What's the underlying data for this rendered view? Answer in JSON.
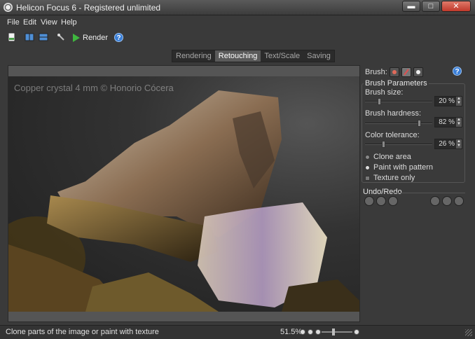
{
  "window": {
    "title": "Helicon Focus 6 - Registered unlimited",
    "minimize": "▬",
    "maximize": "□",
    "close": "✕"
  },
  "menu": [
    "File",
    "Edit",
    "View",
    "Help"
  ],
  "toolbar": {
    "render_label": "Render",
    "help_label": "?"
  },
  "tabs": [
    {
      "label": "Rendering",
      "active": false
    },
    {
      "label": "Retouching",
      "active": true
    },
    {
      "label": "Text/Scale",
      "active": false
    },
    {
      "label": "Saving",
      "active": false
    }
  ],
  "image": {
    "watermark": "Copper crystal 4 mm © Honorio Cócera"
  },
  "panel": {
    "brush_label": "Brush:",
    "help": "?",
    "group_title": "Brush Parameters",
    "brush_size": {
      "label": "Brush size:",
      "value": "20 %",
      "level": 0.2
    },
    "brush_hardness": {
      "label": "Brush hardness:",
      "value": "82 %",
      "level": 0.82
    },
    "color_tolerance": {
      "label": "Color tolerance:",
      "value": "26 %",
      "level": 0.26
    },
    "options": [
      {
        "label": "Clone area",
        "selected": false
      },
      {
        "label": "Paint with pattern",
        "selected": true
      }
    ],
    "texture_only": "Texture only",
    "undo_title": "Undo/Redo"
  },
  "status": {
    "text": "Clone parts of the image or paint with texture",
    "zoom": "51.5%"
  },
  "colors": {
    "accent": "#3b7fd8",
    "render_green": "#3fb63f",
    "close_red": "#c0392b"
  }
}
